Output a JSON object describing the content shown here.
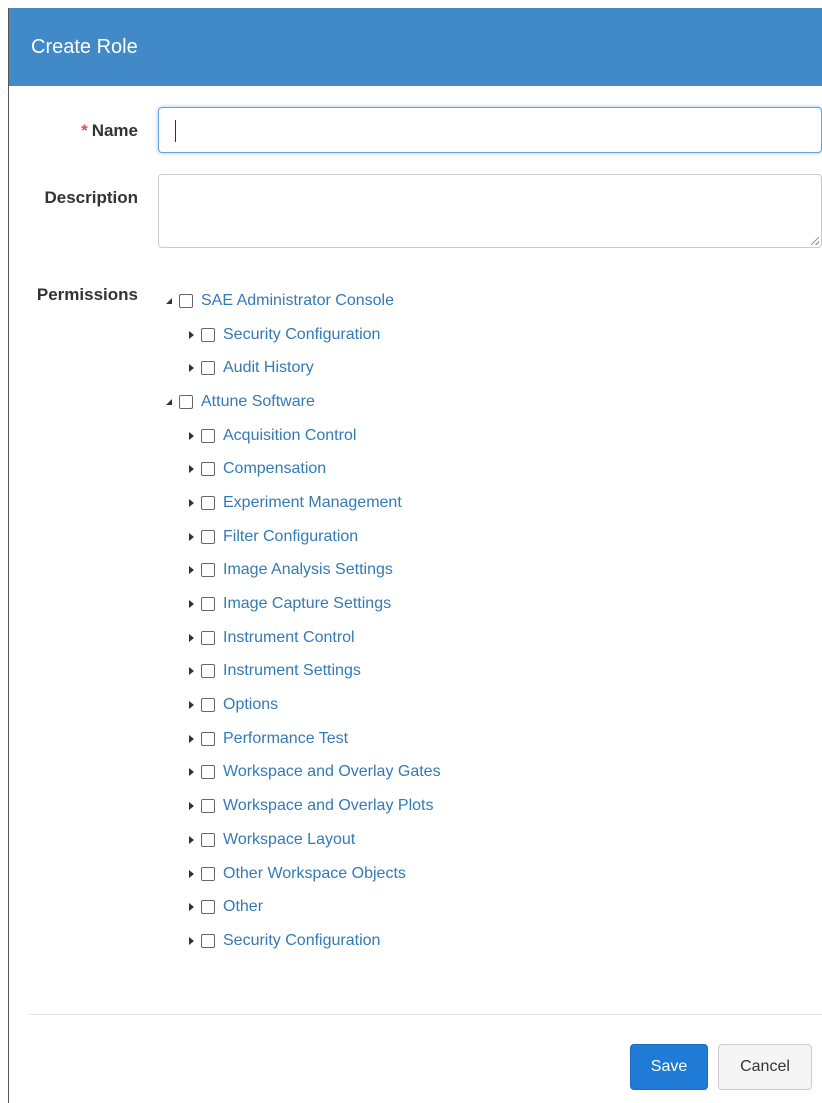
{
  "dialog": {
    "title": "Create Role"
  },
  "form": {
    "name_required_mark": "*",
    "name_label": "Name",
    "name_value": "",
    "description_label": "Description",
    "description_value": "",
    "permissions_label": "Permissions"
  },
  "permissions": {
    "groups": [
      {
        "label": "SAE Administrator Console",
        "expanded": true,
        "checked": false,
        "children": [
          {
            "label": "Security Configuration",
            "expanded": false,
            "checked": false
          },
          {
            "label": "Audit History",
            "expanded": false,
            "checked": false
          }
        ]
      },
      {
        "label": "Attune Software",
        "expanded": true,
        "checked": false,
        "children": [
          {
            "label": "Acquisition Control",
            "expanded": false,
            "checked": false
          },
          {
            "label": "Compensation",
            "expanded": false,
            "checked": false
          },
          {
            "label": "Experiment Management",
            "expanded": false,
            "checked": false
          },
          {
            "label": "Filter Configuration",
            "expanded": false,
            "checked": false
          },
          {
            "label": "Image Analysis Settings",
            "expanded": false,
            "checked": false
          },
          {
            "label": "Image Capture Settings",
            "expanded": false,
            "checked": false
          },
          {
            "label": "Instrument Control",
            "expanded": false,
            "checked": false
          },
          {
            "label": "Instrument Settings",
            "expanded": false,
            "checked": false
          },
          {
            "label": "Options",
            "expanded": false,
            "checked": false
          },
          {
            "label": "Performance Test",
            "expanded": false,
            "checked": false
          },
          {
            "label": "Workspace and Overlay Gates",
            "expanded": false,
            "checked": false
          },
          {
            "label": "Workspace and Overlay Plots",
            "expanded": false,
            "checked": false
          },
          {
            "label": "Workspace Layout",
            "expanded": false,
            "checked": false
          },
          {
            "label": "Other Workspace Objects",
            "expanded": false,
            "checked": false
          },
          {
            "label": "Other",
            "expanded": false,
            "checked": false
          },
          {
            "label": "Security Configuration",
            "expanded": false,
            "checked": false
          }
        ]
      }
    ]
  },
  "footer": {
    "save_label": "Save",
    "cancel_label": "Cancel"
  },
  "colors": {
    "header_bg": "#4189c7",
    "link": "#337ab7",
    "primary_button": "#1f7bd6",
    "required": "#d9534f"
  }
}
